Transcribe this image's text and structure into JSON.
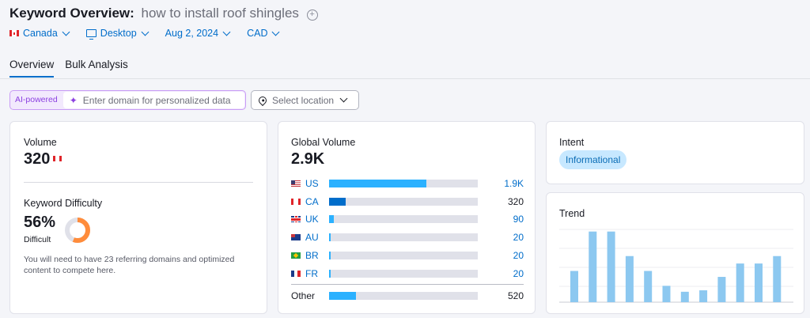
{
  "header": {
    "title_prefix": "Keyword Overview:",
    "keyword": "how to install roof shingles",
    "add_icon": "plus-circle-icon"
  },
  "filters": {
    "country": "Canada",
    "device": "Desktop",
    "date": "Aug 2, 2024",
    "currency": "CAD"
  },
  "tabs": [
    {
      "label": "Overview",
      "active": true
    },
    {
      "label": "Bulk Analysis",
      "active": false
    }
  ],
  "ai_bar": {
    "badge": "AI-powered",
    "placeholder": "Enter domain for personalized data",
    "location_placeholder": "Select location"
  },
  "volume_card": {
    "title": "Volume",
    "value": "320",
    "kd_title": "Keyword Difficulty",
    "kd_value": "56%",
    "kd_percent": 56,
    "kd_label": "Difficult",
    "kd_description": "You will need to have 23 referring domains and optimized content to compete here."
  },
  "global_card": {
    "title": "Global Volume",
    "value": "2.9K",
    "rows": [
      {
        "code": "US",
        "flag": "fl-us",
        "display": "1.9K",
        "volume": 1900,
        "highlight": false
      },
      {
        "code": "CA",
        "flag": "fl-ca",
        "display": "320",
        "volume": 320,
        "highlight": true
      },
      {
        "code": "UK",
        "flag": "fl-uk",
        "display": "90",
        "volume": 90,
        "highlight": false
      },
      {
        "code": "AU",
        "flag": "fl-au",
        "display": "20",
        "volume": 20,
        "highlight": false
      },
      {
        "code": "BR",
        "flag": "fl-br",
        "display": "20",
        "volume": 20,
        "highlight": false
      },
      {
        "code": "FR",
        "flag": "fl-fr",
        "display": "20",
        "volume": 20,
        "highlight": false
      }
    ],
    "other": {
      "label": "Other",
      "display": "520",
      "volume": 520
    }
  },
  "intent_card": {
    "title": "Intent",
    "value": "Informational"
  },
  "trend_card": {
    "title": "Trend",
    "values": [
      0.42,
      0.95,
      0.95,
      0.62,
      0.42,
      0.22,
      0.14,
      0.16,
      0.34,
      0.52,
      0.52,
      0.62
    ]
  },
  "colors": {
    "accent": "#006dca",
    "bar": "#2bb1ff",
    "bar_highlight": "#006dca",
    "donut": "#ff8c3b",
    "trend_bar": "#8cc8f0"
  }
}
